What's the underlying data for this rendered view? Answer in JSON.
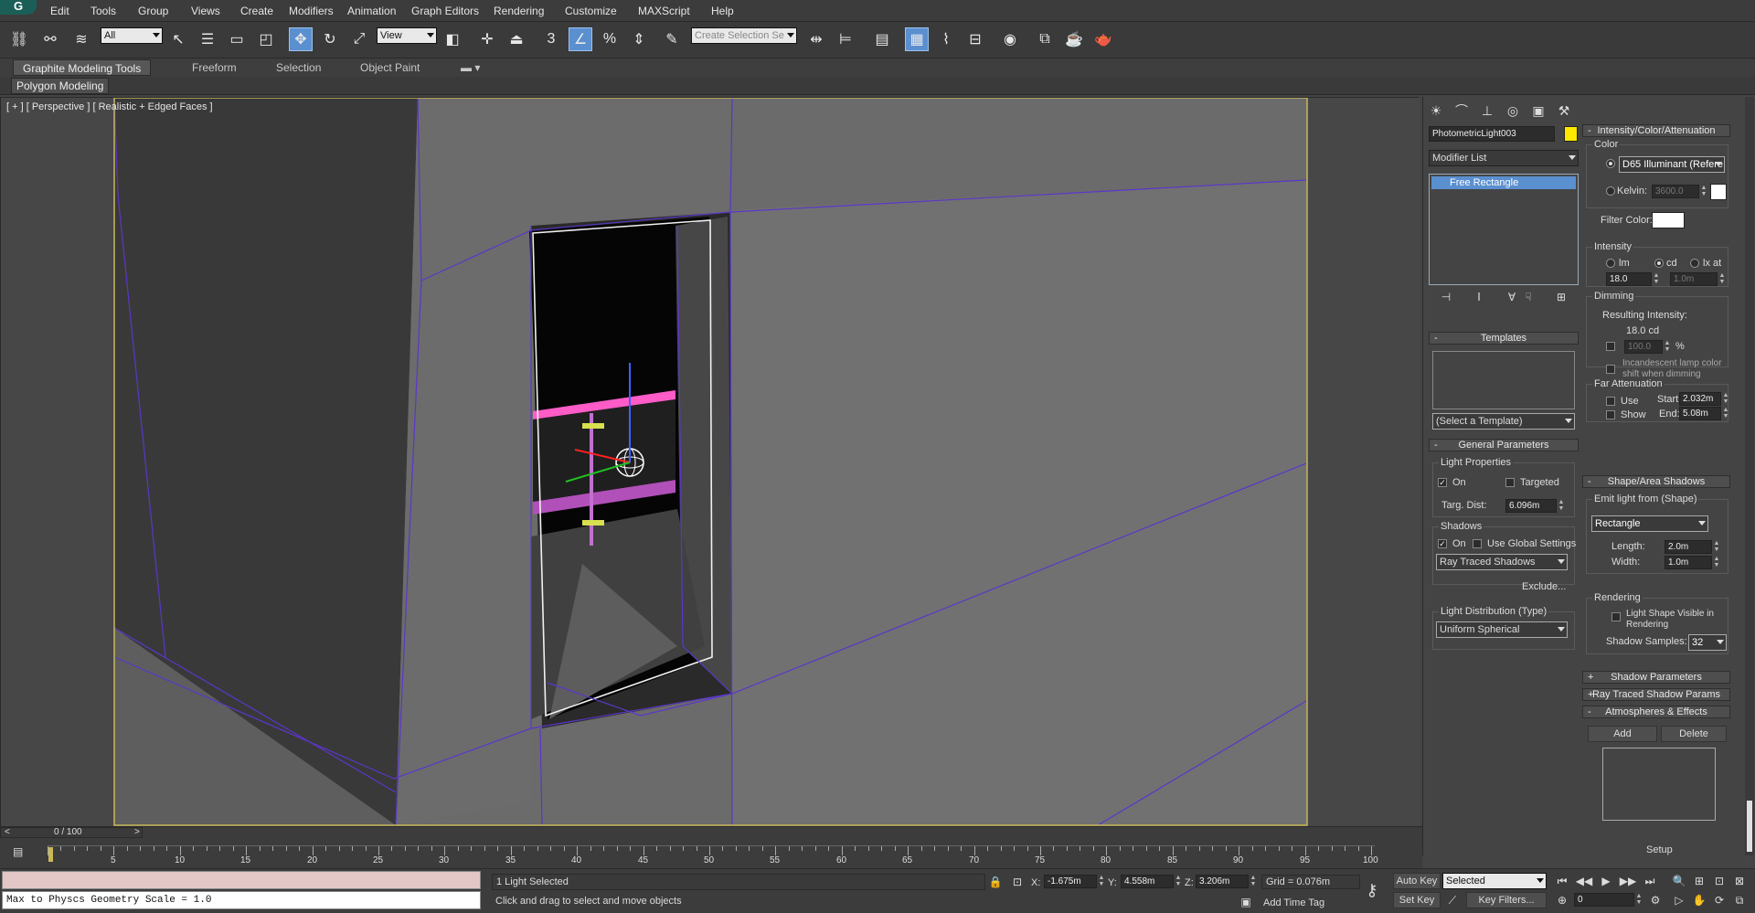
{
  "menu": [
    "Edit",
    "Tools",
    "Group",
    "Views",
    "Create",
    "Modifiers",
    "Animation",
    "Graph Editors",
    "Rendering",
    "Customize",
    "MAXScript",
    "Help"
  ],
  "toolbar": {
    "filter_value": "All",
    "ref_coord_value": "View",
    "named_selection_placeholder": "Create Selection Se",
    "snap_3": "3",
    "angle_snap": "n",
    "percent_snap": "%",
    "spinner_snap": "n"
  },
  "ribbon": {
    "tabs": [
      "Graphite Modeling Tools",
      "Freeform",
      "Selection",
      "Object Paint"
    ],
    "sub_tab": "Polygon Modeling"
  },
  "viewport": {
    "label": "[ + ] [ Perspective ] [ Realistic + Edged Faces ]"
  },
  "command_panel": {
    "object_name": "PhotometricLight003",
    "object_color": "#ffe800",
    "modifier_list_label": "Modifier List",
    "stack_item": "Free Rectangle",
    "templates": {
      "title": "Templates",
      "select_label": "(Select a Template)"
    },
    "general": {
      "title": "General Parameters",
      "light_properties": "Light Properties",
      "on_label": "On",
      "targeted_label": "Targeted",
      "targ_dist_label": "Targ. Dist:",
      "targ_dist_value": "6.096m",
      "shadows_label": "Shadows",
      "shadows_on_label": "On",
      "use_global_label": "Use Global Settings",
      "shadow_type": "Ray Traced Shadows",
      "exclude_label": "Exclude...",
      "distribution_label": "Light Distribution (Type)",
      "distribution_value": "Uniform Spherical"
    },
    "intensity": {
      "title": "Intensity/Color/Attenuation",
      "color_label": "Color",
      "color_preset": "D65 Illuminant (Refere",
      "kelvin_label": "Kelvin:",
      "kelvin_value": "3600.0",
      "filter_color_label": "Filter Color:",
      "intensity_label": "Intensity",
      "lm_label": "lm",
      "cd_label": "cd",
      "lx_label": "lx at",
      "intensity_value": "18.0",
      "lx_value": "1.0m",
      "dimming_label": "Dimming",
      "resulting_label": "Resulting Intensity:",
      "resulting_value": "18.0 cd",
      "dim_percent_value": "100.0",
      "percent_sign": "%",
      "incandescent_label_1": "Incandescent lamp color",
      "incandescent_label_2": "shift when dimming",
      "far_atten_label": "Far Attenuation",
      "use_label": "Use",
      "show_label": "Show",
      "start_label": "Start:",
      "start_value": "2.032m",
      "end_label": "End:",
      "end_value": "5.08m"
    },
    "shape": {
      "title": "Shape/Area Shadows",
      "emit_label": "Emit light from (Shape)",
      "shape_value": "Rectangle",
      "length_label": "Length:",
      "length_value": "2.0m",
      "width_label": "Width:",
      "width_value": "1.0m",
      "rendering_label": "Rendering",
      "visible_label_1": "Light Shape Visible in",
      "visible_label_2": "Rendering",
      "samples_label": "Shadow Samples:",
      "samples_value": "32"
    },
    "collapsed": {
      "shadow_params": "Shadow Parameters",
      "ray_traced": "Ray Traced Shadow Params",
      "atmos": "Atmospheres & Effects"
    },
    "atmos_add": "Add",
    "atmos_delete": "Delete",
    "atmos_setup": "Setup"
  },
  "timeline": {
    "frame_counter": "0 / 100",
    "ticks": [
      "5",
      "10",
      "15",
      "20",
      "25",
      "30",
      "35",
      "40",
      "45",
      "50",
      "55",
      "60",
      "65",
      "70",
      "75",
      "80",
      "85",
      "90",
      "95",
      "100"
    ]
  },
  "status": {
    "listener_text": "Max to Physcs Geometry Scale = 1.0",
    "selection_text": "1 Light Selected",
    "prompt_text": "Click and drag to select and move objects",
    "x_label": "X:",
    "x_value": "-1.675m",
    "y_label": "Y:",
    "y_value": "4.558m",
    "z_label": "Z:",
    "z_value": "3.206m",
    "grid_text": "Grid = 0.076m",
    "add_time_tag": "Add Time Tag",
    "auto_key": "Auto Key",
    "set_key": "Set Key",
    "key_mode_value": "Selected",
    "key_filters": "Key Filters...",
    "current_frame": "0"
  }
}
